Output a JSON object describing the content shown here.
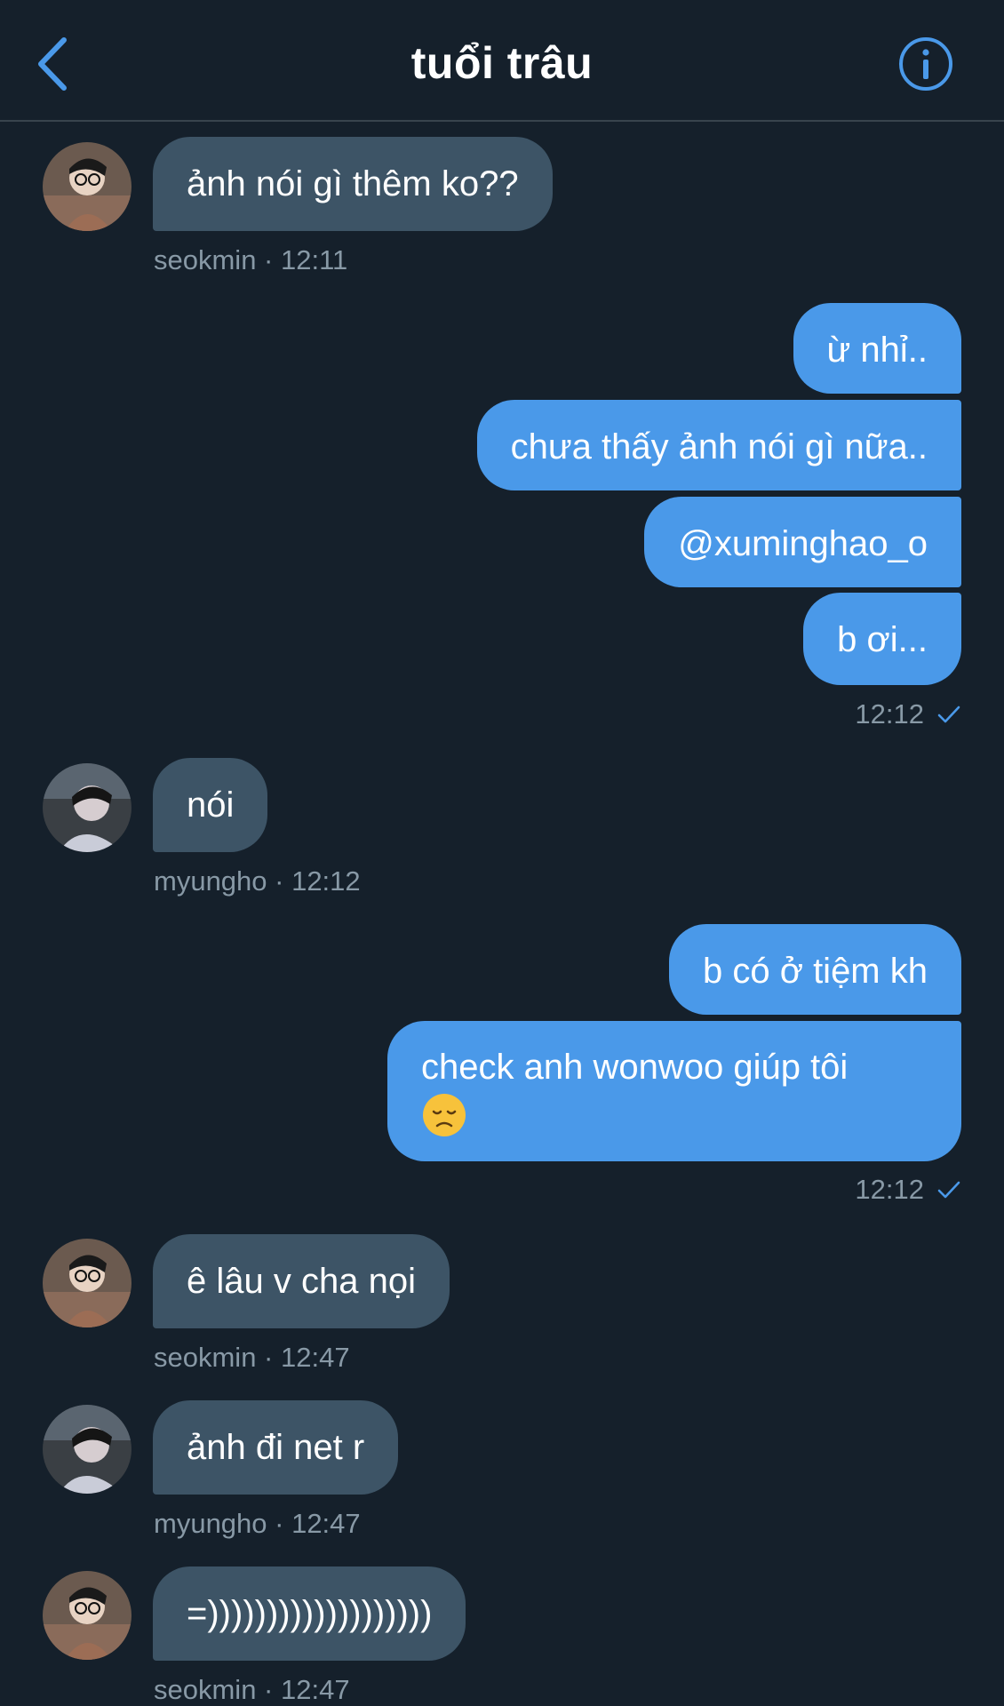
{
  "header": {
    "title": "tuổi trâu",
    "back_icon": "chevron-left-icon",
    "info_icon": "info-circle-icon",
    "accent_color": "#4a99e9"
  },
  "messages": [
    {
      "sender": "seokmin",
      "text": "ảnh nói gì thêm ko??",
      "meta": "seokmin · 12:11"
    },
    {
      "sender": "me",
      "text": "ừ nhỉ.."
    },
    {
      "sender": "me",
      "text": "chưa thấy ảnh nói gì nữa.."
    },
    {
      "sender": "me",
      "text": "@xuminghao_o"
    },
    {
      "sender": "me",
      "text": "b ơi...",
      "meta": "12:12"
    },
    {
      "sender": "myungho",
      "text": "nói",
      "meta": "myungho · 12:12"
    },
    {
      "sender": "me",
      "text": "b có ở tiệm kh"
    },
    {
      "sender": "me",
      "text": "check anh wonwoo giúp tôi",
      "emoji": "disappointed-face-emoji",
      "meta": "12:12"
    },
    {
      "sender": "seokmin",
      "text": "ê lâu v cha nọi",
      "meta": "seokmin · 12:47"
    },
    {
      "sender": "myungho",
      "text": "ảnh đi net r",
      "meta": "myungho · 12:47"
    },
    {
      "sender": "seokmin",
      "text": "=)))))))))))))))))))",
      "meta": "seokmin · 12:47"
    }
  ],
  "colors": {
    "background": "#15202b",
    "incoming_bubble": "#3d5466",
    "outgoing_bubble": "#4a99e9",
    "meta_text": "#8899a6"
  }
}
